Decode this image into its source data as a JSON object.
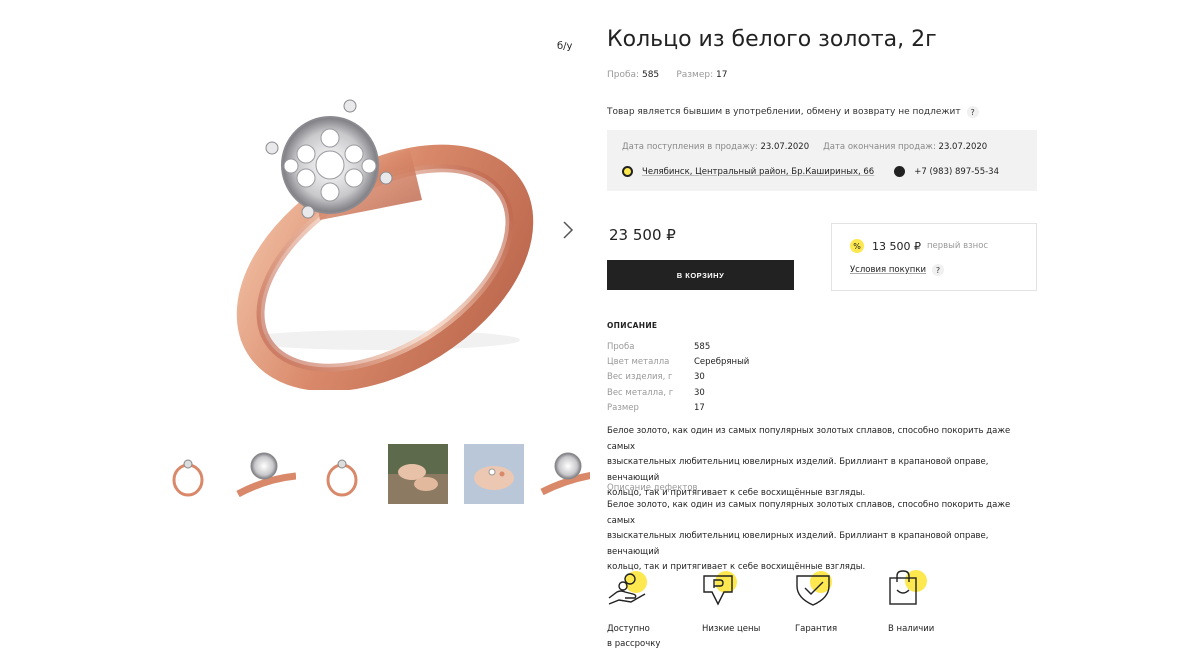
{
  "product": {
    "title": "Кольцо из белого золота, 2г",
    "badge": "б/у",
    "probe_label": "Проба:",
    "probe_value": "585",
    "size_label": "Размер:",
    "size_value": "17",
    "notice": "Товар является бывшим в употреблении, обмену и возврату не подлежит",
    "notice_help": "?"
  },
  "store": {
    "arrival_label": "Дата поступления в продажу:",
    "arrival_value": "23.07.2020",
    "end_label": "Дата окончания продаж:",
    "end_value": "23.07.2020",
    "address": "Челябинск, Центральный район, Бр.Кашириных, 66",
    "phone": "+7 (983) 897-55-34"
  },
  "purchase": {
    "price": "23 500 ₽",
    "cart_button": "В КОРЗИНУ",
    "installment_icon": "%",
    "installment_amount": "13 500 ₽",
    "installment_label": "первый взнос",
    "terms_link": "Условия покупки",
    "terms_help": "?"
  },
  "description": {
    "heading": "ОПИСАНИЕ",
    "specs": [
      {
        "key": "Проба",
        "value": "585"
      },
      {
        "key": "Цвет металла",
        "value": "Серебряный"
      },
      {
        "key": "Вес изделия, г",
        "value": "30"
      },
      {
        "key": "Вес металла, г",
        "value": "30"
      },
      {
        "key": "Размер",
        "value": "17"
      }
    ],
    "text_lines": [
      "Белое золото, как один из самых популярных золотых сплавов, способно покорить даже самых",
      "взыскательных любительниц ювелирных изделий. Бриллиант в крапановой оправе, венчающий",
      "кольцо, так и притягивает к себе восхищённые взгляды."
    ],
    "defects_heading": "Описание дефектов",
    "defects_lines": [
      "Белое золото, как один из самых популярных золотых сплавов, способно покорить даже самых",
      "взыскательных любительниц ювелирных изделий. Бриллиант в крапановой оправе, венчающий",
      "кольцо, так и притягивает к себе восхищённые взгляды."
    ]
  },
  "features": [
    {
      "icon": "hand-coins-icon",
      "line1": "Доступно",
      "line2": "в рассрочку"
    },
    {
      "icon": "low-price-tag-icon",
      "line1": "Низкие цены",
      "line2": ""
    },
    {
      "icon": "shield-check-icon",
      "line1": "Гарантия",
      "line2": ""
    },
    {
      "icon": "shopping-bag-icon",
      "line1": "В наличии",
      "line2": ""
    }
  ],
  "colors": {
    "accent": "#fde84f",
    "button": "#222222",
    "rose_gold": "#d9937a",
    "info_bg": "#f2f2f2"
  }
}
